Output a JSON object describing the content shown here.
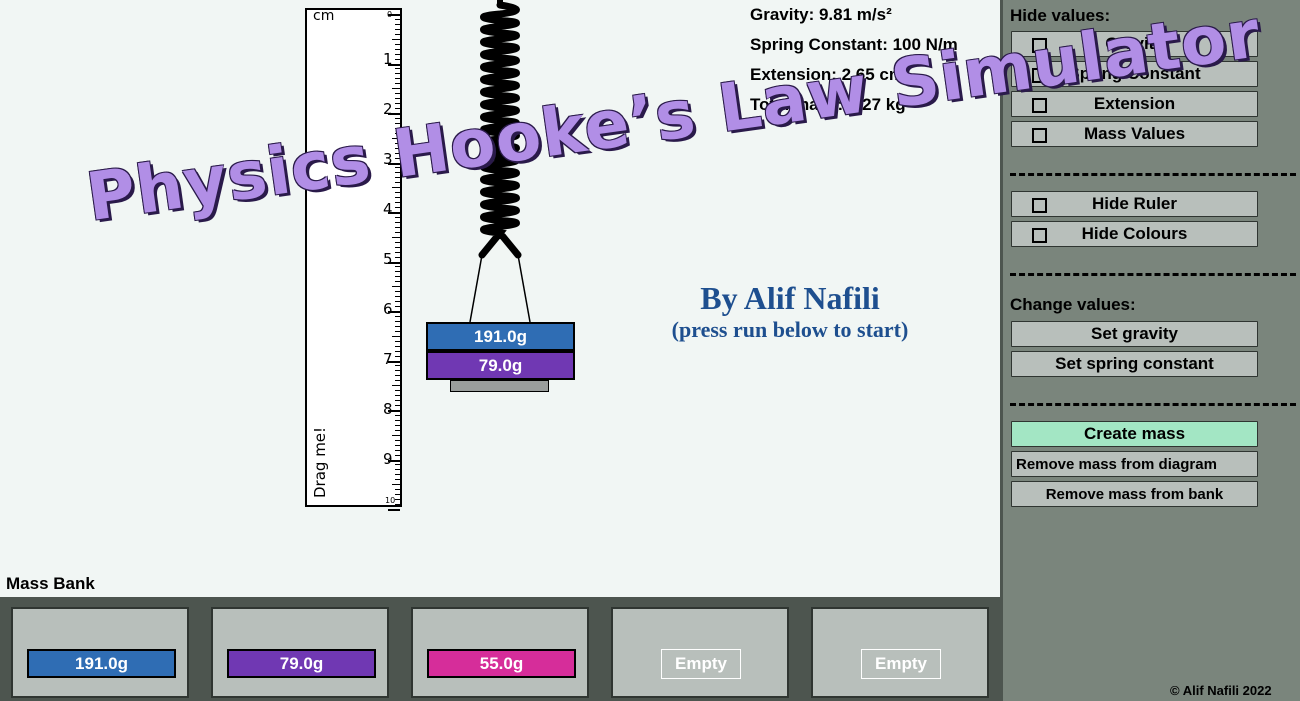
{
  "readouts": {
    "gravity": "Gravity: 9.81 m/s²",
    "spring_constant": "Spring Constant: 100 N/m",
    "extension": "Extension: 2.65 cm",
    "total_mass": "Total mass: 0.27 kg"
  },
  "ruler": {
    "unit": "cm",
    "labels": [
      "1",
      "2",
      "3",
      "4",
      "5",
      "6",
      "7",
      "8",
      "9"
    ],
    "zero": "0",
    "ten": "10",
    "drag_hint": "Drag me!"
  },
  "hanging_masses": [
    {
      "label": "191.0g",
      "color": "#2f6db4"
    },
    {
      "label": "79.0g",
      "color": "#7038b3"
    }
  ],
  "banner": {
    "title": "Physics Hooke’s Law Simulator",
    "author": "By Alif Nafili",
    "hint": "(press run below to start)"
  },
  "panel": {
    "hide_values_header": "Hide values:",
    "hide_values": [
      {
        "label": "Gravity",
        "checked": false
      },
      {
        "label": "Spring Constant",
        "checked": false
      },
      {
        "label": "Extension",
        "checked": false
      },
      {
        "label": "Mass Values",
        "checked": false
      }
    ],
    "hide_ruler": "Hide Ruler",
    "hide_colours": "Hide Colours",
    "change_values_header": "Change values:",
    "set_gravity": "Set gravity",
    "set_spring_constant": "Set spring constant",
    "create_mass": "Create mass",
    "remove_from_diagram": "Remove mass from diagram",
    "remove_from_bank": "Remove mass from bank"
  },
  "mass_bank": {
    "title": "Mass Bank",
    "slots": [
      {
        "label": "191.0g",
        "color": "#2f6db4"
      },
      {
        "label": "79.0g",
        "color": "#7038b3"
      },
      {
        "label": "55.0g",
        "color": "#d62d9a"
      },
      {
        "label": "Empty"
      },
      {
        "label": "Empty"
      }
    ]
  },
  "copyright": "© Alif Nafili 2022"
}
